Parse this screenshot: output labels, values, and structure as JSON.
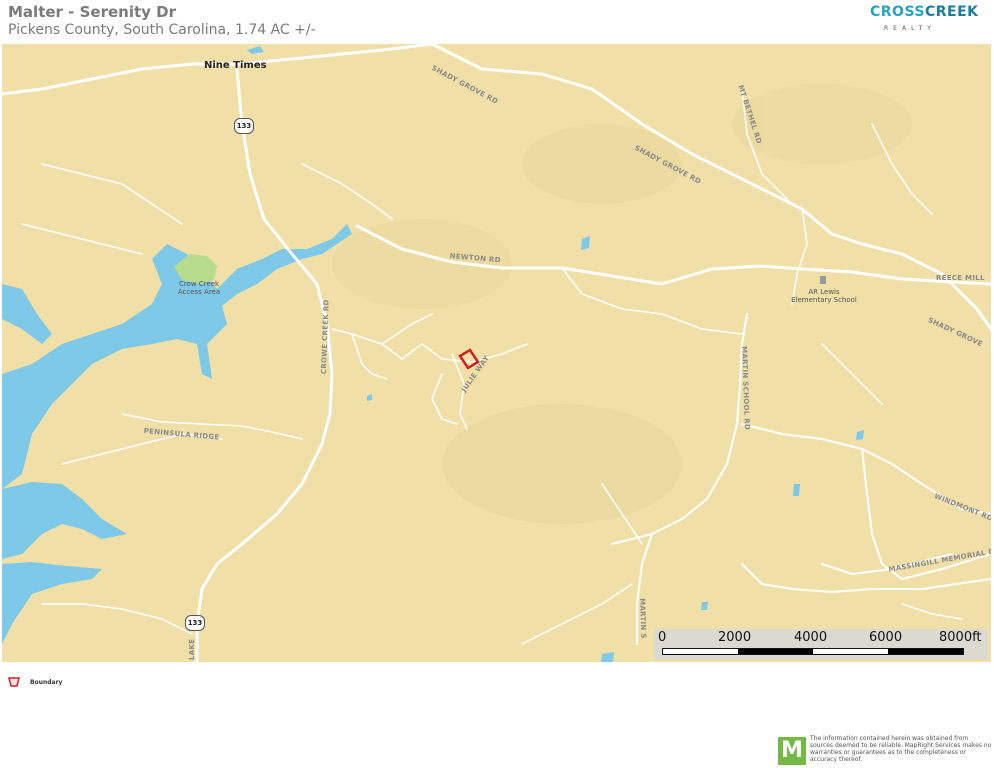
{
  "header": {
    "title": "Malter - Serenity Dr",
    "subtitle": "Pickens County, South Carolina, 1.74 AC +/-"
  },
  "brand": {
    "name_part1": "CROSS",
    "name_part2": "CREEK",
    "tagline": "REALTY"
  },
  "map": {
    "places": [
      {
        "id": "nine-times",
        "text": "Nine Times"
      }
    ],
    "road_labels": {
      "shady_grove_1": "SHADY GROVE RD",
      "shady_grove_2": "SHADY GROVE RD",
      "shady_grove_3": "SHADY GROVE",
      "mt_bethel": "MT BETHEL RD",
      "newton": "NEWTON RD",
      "reece_mill": "REECE MILL",
      "crowe_creek": "CROWE CREEK RD",
      "julie_way": "JULIE WAY",
      "martin_school": "MARTIN SCHOOL RD",
      "martin_school_2": "MARTIN S",
      "peninsula_ridge": "PENINSULA RIDGE",
      "windmont": "WINDMONT RD",
      "massingill": "MASSINGILL MEMORIAL DR",
      "lake": "LAKE"
    },
    "poi": {
      "crow_creek": "Crow Creek Access Area",
      "school": "AR Lewis Elementary School"
    },
    "shields": {
      "hwy_top": "133",
      "hwy_bottom": "133"
    },
    "colors": {
      "land": "#f0e0a8",
      "water": "#7ec8e8",
      "road": "#ffffff",
      "park": "#b7dc8e",
      "boundary": "#cc2222"
    }
  },
  "scale": {
    "labels": [
      "0",
      "2000",
      "4000",
      "6000",
      "8000ft"
    ]
  },
  "legend": {
    "label": "Boundary"
  },
  "footer": {
    "logo_letter": "M",
    "disclaimer": "The information contained herein was obtained from sources deemed to be reliable. MapRight Services makes no warranties or guarantees as to the completeness or accuracy thereof."
  }
}
